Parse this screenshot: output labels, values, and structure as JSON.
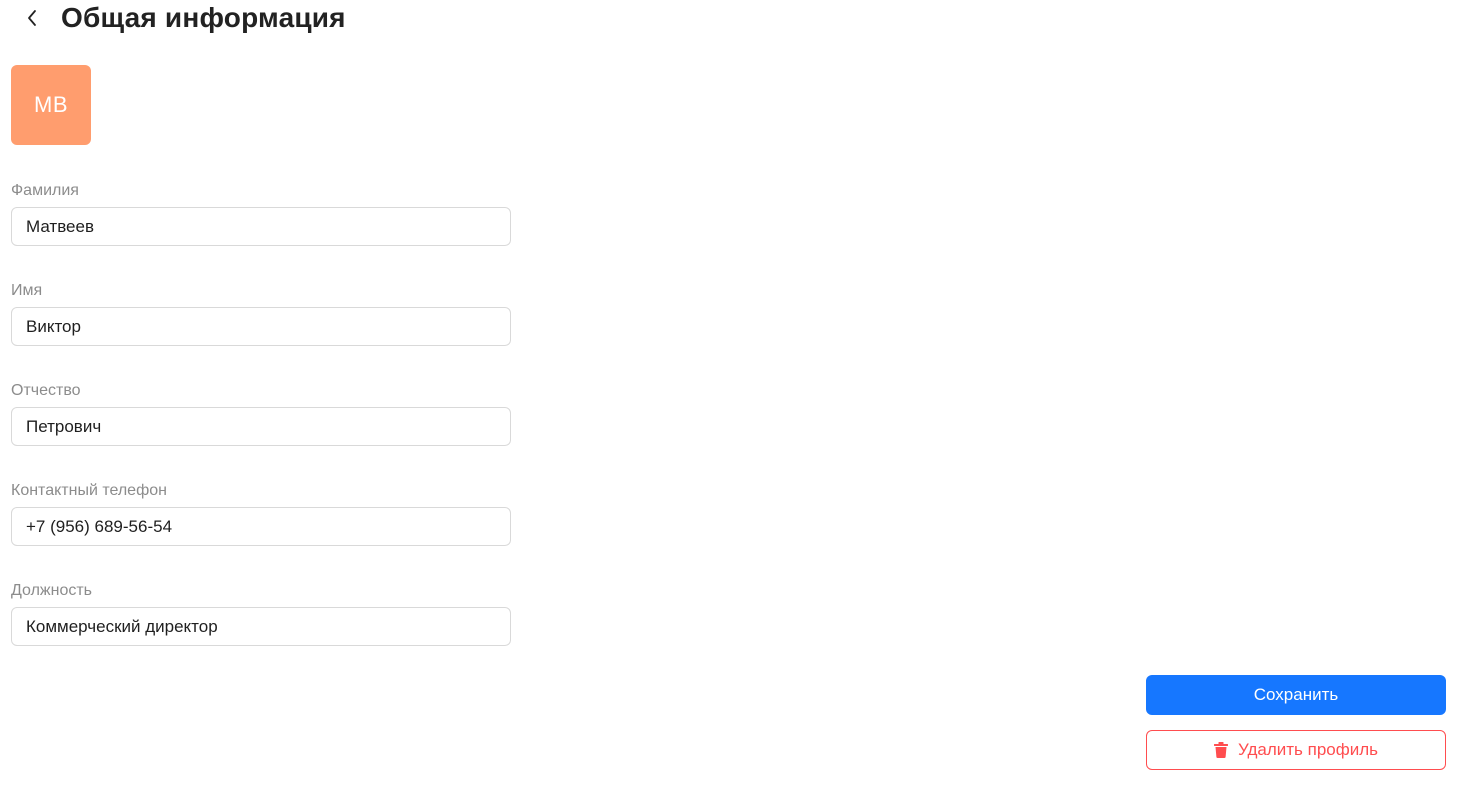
{
  "header": {
    "title": "Общая информация",
    "back_icon": "chevron-left-icon"
  },
  "avatar": {
    "initials": "MB",
    "color": "#ff9d6e"
  },
  "form": {
    "fields": [
      {
        "label": "Фамилия",
        "value": "Матвеев"
      },
      {
        "label": "Имя",
        "value": "Виктор"
      },
      {
        "label": "Отчество",
        "value": "Петрович"
      },
      {
        "label": "Контактный телефон",
        "value": "+7 (956) 689-56-54"
      },
      {
        "label": "Должность",
        "value": "Коммерческий директор"
      }
    ]
  },
  "actions": {
    "save_label": "Сохранить",
    "delete_label": "Удалить профиль",
    "delete_icon": "trash-icon",
    "primary_color": "#1677ff",
    "danger_color": "#ff4d4f"
  }
}
